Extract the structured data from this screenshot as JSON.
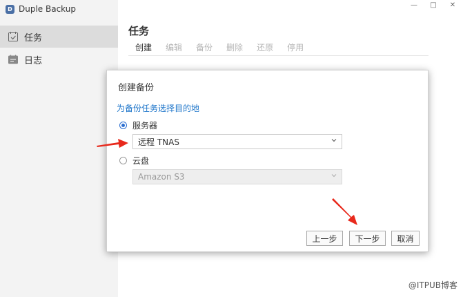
{
  "app": {
    "title": "Duple Backup",
    "logo_text": "D"
  },
  "sidebar": {
    "items": [
      {
        "label": "任务",
        "icon": "calendar-check-icon",
        "active": true
      },
      {
        "label": "日志",
        "icon": "calendar-list-icon",
        "active": false
      }
    ]
  },
  "window_controls": {
    "minimize": "—",
    "maximize": "□",
    "close": "✕"
  },
  "main": {
    "title": "任务",
    "toolbar": [
      {
        "label": "创建",
        "enabled": true
      },
      {
        "label": "编辑",
        "enabled": false
      },
      {
        "label": "备份",
        "enabled": false
      },
      {
        "label": "删除",
        "enabled": false
      },
      {
        "label": "还原",
        "enabled": false
      },
      {
        "label": "停用",
        "enabled": false
      }
    ]
  },
  "dialog": {
    "title": "创建备份",
    "subtitle": "为备份任务选择目的地",
    "option_server": {
      "label": "服务器",
      "checked": true,
      "select_value": "远程 TNAS"
    },
    "option_cloud": {
      "label": "云盘",
      "checked": false,
      "select_value": "Amazon S3"
    },
    "buttons": {
      "prev": "上一步",
      "next": "下一步",
      "cancel": "取消"
    }
  },
  "watermark": "@ITPUB博客",
  "colors": {
    "accent": "#2c6fd1",
    "link": "#1a73c9",
    "arrow": "#e8291c"
  }
}
